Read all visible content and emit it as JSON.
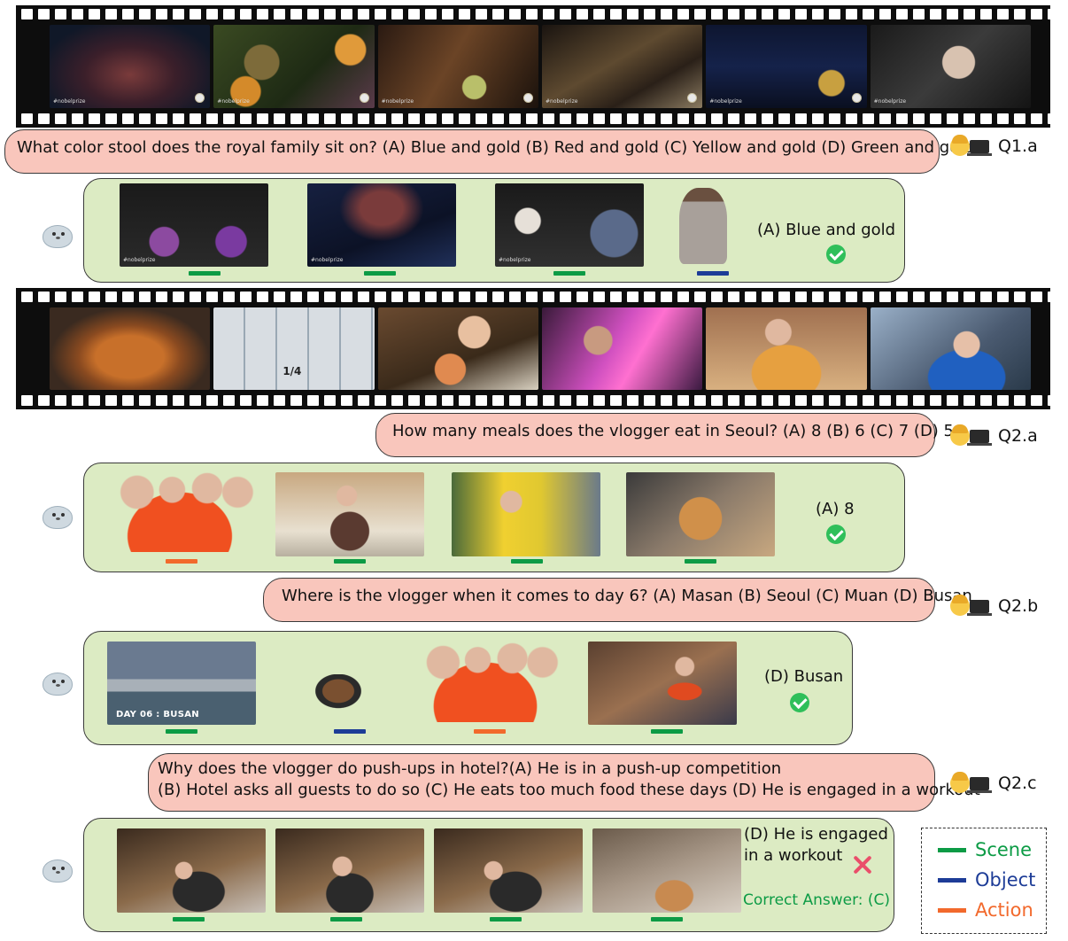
{
  "colors": {
    "scene": "#0c9b45",
    "object": "#1d3c97",
    "action": "#f2692c",
    "question_bg": "#f9c6bc",
    "answer_bg": "#dcebc3",
    "correct": "#2fbf5a",
    "wrong": "#ea4e6a",
    "correct_answer_text": "#0c9b45"
  },
  "video1": {
    "frames": [
      {
        "watermark": "#nobelprize"
      },
      {
        "watermark": "#nobelprize"
      },
      {
        "watermark": "#nobelprize"
      },
      {
        "watermark": "#nobelprize"
      },
      {
        "watermark": "#nobelprize"
      },
      {
        "watermark": "#nobelprize"
      }
    ]
  },
  "q1a": {
    "tag": "Q1.a",
    "question": "What color stool does the royal family sit on? (A) Blue and gold (B) Red and gold (C) Yellow and gold (D) Green and gold",
    "answer": "(A) Blue and gold",
    "result_icon": "check-icon",
    "evidence": [
      {
        "kind": "Scene",
        "watermark": "#nobelprize"
      },
      {
        "kind": "Scene",
        "watermark": "#nobelprize"
      },
      {
        "kind": "Scene",
        "watermark": "#nobelprize"
      },
      {
        "kind": "Object"
      }
    ]
  },
  "video2": {
    "frames": [
      {
        "text": ""
      },
      {
        "text": "1/4"
      },
      {
        "text": ""
      },
      {
        "text": ""
      },
      {
        "text": ""
      },
      {
        "text": ""
      }
    ]
  },
  "q2a": {
    "tag": "Q2.a",
    "question": "How many meals does the vlogger eat in Seoul? (A) 8 (B) 6 (C) 7 (D) 5",
    "answer": "(A) 8",
    "result_icon": "check-icon",
    "evidence": [
      {
        "kind": "Action"
      },
      {
        "kind": "Scene"
      },
      {
        "kind": "Scene"
      },
      {
        "kind": "Scene"
      }
    ]
  },
  "q2b": {
    "tag": "Q2.b",
    "question": "Where is the vlogger when it comes to day 6? (A) Masan (B) Seoul (C) Muan (D) Busan",
    "answer": "(D) Busan",
    "result_icon": "check-icon",
    "frame_caption": "DAY 06 : BUSAN",
    "evidence": [
      {
        "kind": "Scene"
      },
      {
        "kind": "Object"
      },
      {
        "kind": "Action"
      },
      {
        "kind": "Scene"
      }
    ]
  },
  "q2c": {
    "tag": "Q2.c",
    "question_line1": "Why does the vlogger do push-ups in hotel?(A) He is in a push-up competition",
    "question_line2": "(B) Hotel asks all guests to do so (C) He eats too much food these days (D) He is engaged in a workout",
    "answer_line1": "(D) He is engaged",
    "answer_line2": "in a workout",
    "result_icon": "cross-icon",
    "correct_answer": "Correct Answer: (C)",
    "evidence": [
      {
        "kind": "Scene"
      },
      {
        "kind": "Scene"
      },
      {
        "kind": "Scene"
      },
      {
        "kind": "Scene"
      }
    ]
  },
  "legend": {
    "items": [
      {
        "label": "Scene",
        "color": "#0c9b45"
      },
      {
        "label": "Object",
        "color": "#1d3c97"
      },
      {
        "label": "Action",
        "color": "#f2692c"
      }
    ]
  }
}
